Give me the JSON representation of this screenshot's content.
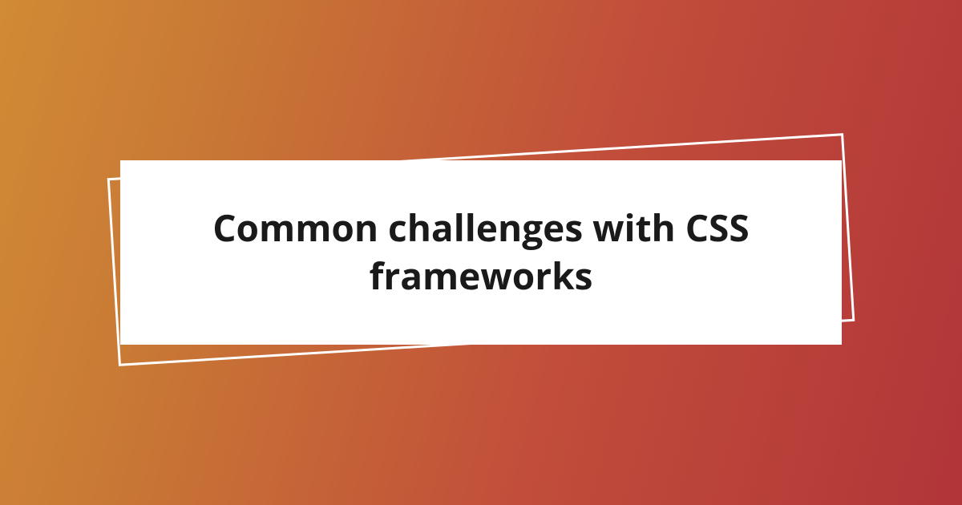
{
  "card": {
    "title": "Common challenges with CSS frameworks"
  }
}
